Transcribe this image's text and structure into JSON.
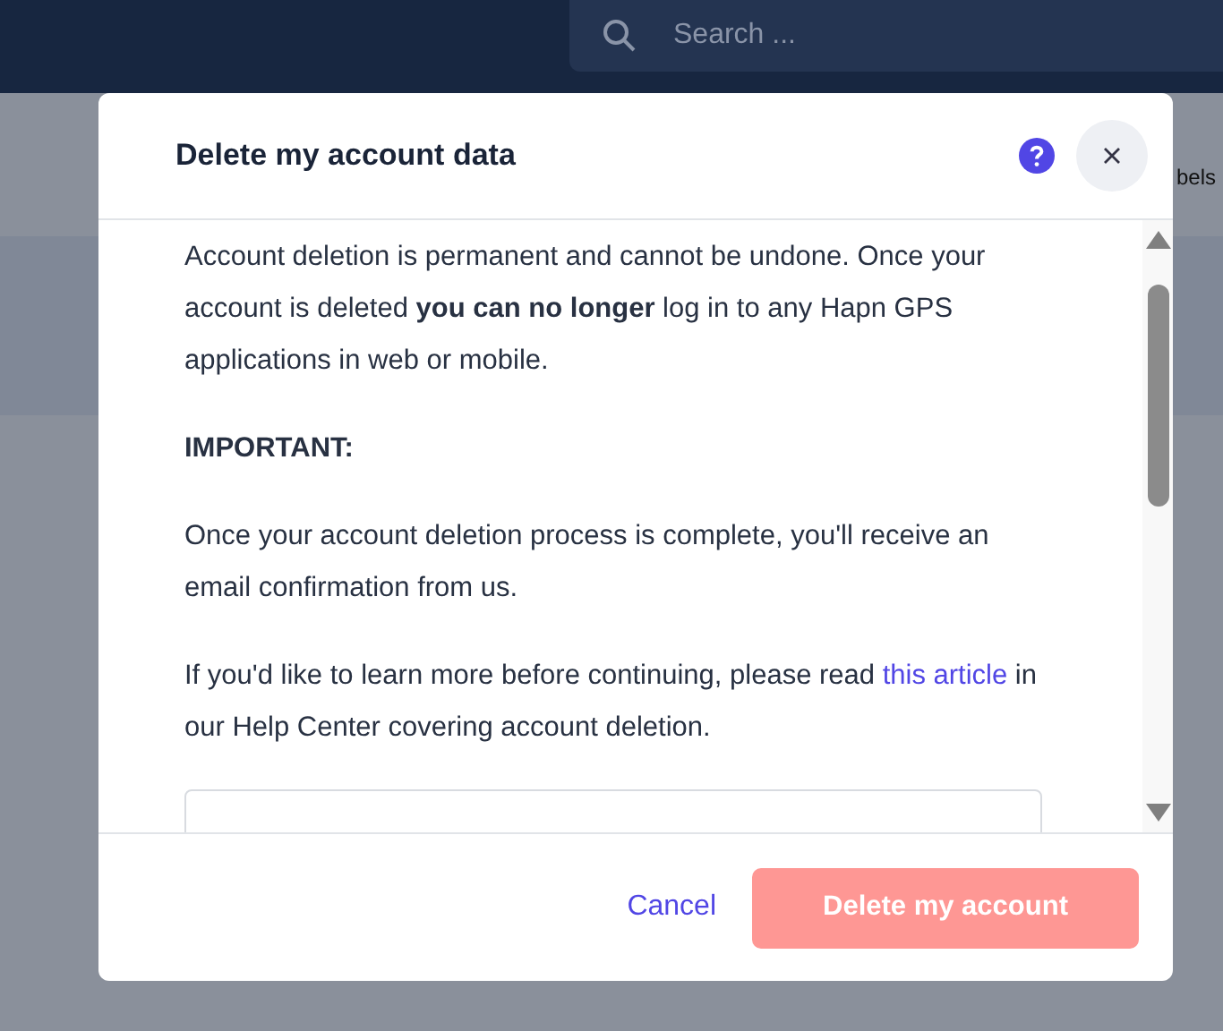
{
  "search": {
    "placeholder": "Search ..."
  },
  "background_text": "bels",
  "dialog": {
    "title": "Delete my account data",
    "paragraphs": [
      {
        "kind": "text",
        "text": "Account deletion is permanent and cannot be undone. Once your account is deleted **you can no longer** log in to any Hapn GPS applications in web or mobile."
      },
      {
        "kind": "heading",
        "text": "IMPORTANT:"
      },
      {
        "kind": "text",
        "text": "Once your account deletion process is complete, you'll receive an email confirmation from us."
      },
      {
        "kind": "link_text",
        "before": "If you'd like to learn more before continuing, please read ",
        "link": "this article",
        "after": " in our Help Center covering account deletion."
      }
    ],
    "buttons": [
      {
        "kind": "link",
        "label": "Cancel",
        "disabled": false
      },
      {
        "kind": "danger",
        "label": "Delete my account",
        "disabled": true
      }
    ]
  }
}
